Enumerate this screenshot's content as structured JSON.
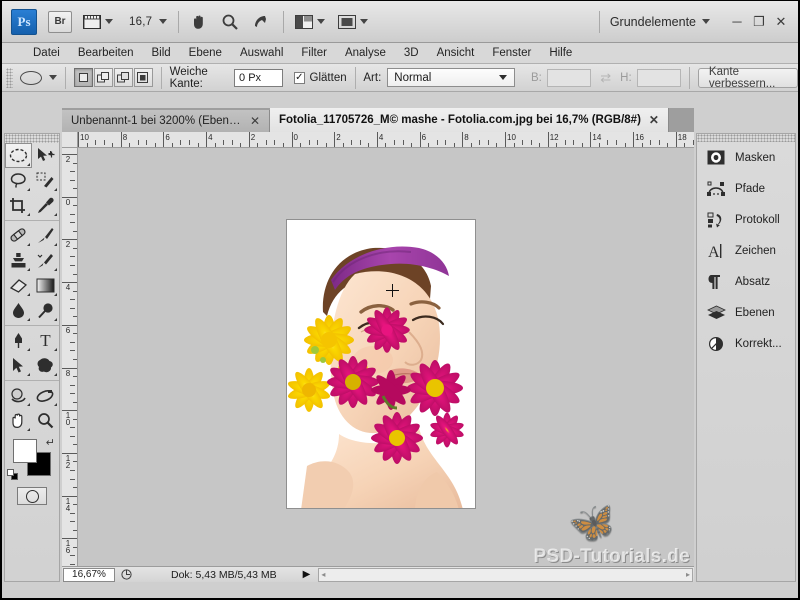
{
  "app": {
    "name": "Adobe Photoshop",
    "logo_text": "Ps",
    "bridge_label": "Br",
    "zoom_level": "16,7",
    "workspace": "Grundelemente"
  },
  "window_controls": {
    "minimize": "─",
    "restore": "❐",
    "close": "✕"
  },
  "menubar": {
    "items": [
      {
        "label": "Datei"
      },
      {
        "label": "Bearbeiten"
      },
      {
        "label": "Bild"
      },
      {
        "label": "Ebene"
      },
      {
        "label": "Auswahl"
      },
      {
        "label": "Filter"
      },
      {
        "label": "Analyse"
      },
      {
        "label": "3D"
      },
      {
        "label": "Ansicht"
      },
      {
        "label": "Fenster"
      },
      {
        "label": "Hilfe"
      }
    ]
  },
  "options_bar": {
    "tool_preset_icon": "ellipse-marquee-icon",
    "selection_modes": [
      "new-selection",
      "add-to-selection",
      "subtract-from-selection",
      "intersect-selection"
    ],
    "feather_label": "Weiche Kante:",
    "feather_value": "0 Px",
    "antialias_label": "Glätten",
    "antialias_checked": true,
    "style_label": "Art:",
    "style_value": "Normal",
    "width_label": "B:",
    "width_value": "",
    "height_label": "H:",
    "height_value": "",
    "refine_edge_label": "Kante verbessern..."
  },
  "tabs": [
    {
      "title": "Unbenannt-1 bei 3200% (Ebene ...",
      "active": false,
      "close": "✕"
    },
    {
      "title": "Fotolia_11705726_M© mashe - Fotolia.com.jpg bei 16,7% (RGB/8#)",
      "active": true,
      "close": "✕"
    }
  ],
  "rulers": {
    "unit": "cm",
    "horizontal_labels": [
      "10",
      "8",
      "6",
      "4",
      "2",
      "0",
      "2",
      "4",
      "6",
      "8",
      "10",
      "12",
      "14",
      "16",
      "18"
    ],
    "vertical_labels": [
      "2",
      "0",
      "2",
      "4",
      "6",
      "8",
      "10",
      "12",
      "14",
      "16"
    ]
  },
  "canvas": {
    "document_name": "Fotolia_11705726_M© mashe - Fotolia.com.jpg",
    "cursor": "crosshair-cursor",
    "watermark_text": "PSD-Tutorials.de",
    "butterfly_icon": "butterfly-icon"
  },
  "statusbar": {
    "zoom": "16,67%",
    "preview_icon": "thumbnail-icon",
    "doc_info": "Dok: 5,43 MB/5,43 MB",
    "menu_arrow": "▶",
    "scroll_left": "◂",
    "scroll_right": "▸"
  },
  "toolbox": {
    "groups": [
      {
        "tools": [
          {
            "name": "elliptical-marquee-tool",
            "glyph": "◯",
            "selected": true,
            "has_flyout": true
          },
          {
            "name": "move-tool",
            "glyph": "✣",
            "selected": false,
            "has_flyout": false
          },
          {
            "name": "lasso-tool",
            "glyph": "❁",
            "selected": false,
            "has_flyout": true
          },
          {
            "name": "quick-selection-tool",
            "glyph": "✦",
            "selected": false,
            "has_flyout": true
          },
          {
            "name": "crop-tool",
            "glyph": "⌧",
            "selected": false,
            "has_flyout": true
          },
          {
            "name": "eyedropper-tool",
            "glyph": "✒",
            "selected": false,
            "has_flyout": true
          }
        ]
      },
      {
        "tools": [
          {
            "name": "spot-healing-brush-tool",
            "glyph": "⊕",
            "selected": false,
            "has_flyout": true
          },
          {
            "name": "brush-tool",
            "glyph": "✎",
            "selected": false,
            "has_flyout": true
          },
          {
            "name": "clone-stamp-tool",
            "glyph": "⚑",
            "selected": false,
            "has_flyout": true
          },
          {
            "name": "history-brush-tool",
            "glyph": "✐",
            "selected": false,
            "has_flyout": true
          },
          {
            "name": "eraser-tool",
            "glyph": "▱",
            "selected": false,
            "has_flyout": true
          },
          {
            "name": "gradient-tool",
            "glyph": "■",
            "selected": false,
            "has_flyout": true
          },
          {
            "name": "blur-tool",
            "glyph": "●",
            "selected": false,
            "has_flyout": true
          },
          {
            "name": "dodge-tool",
            "glyph": "⚲",
            "selected": false,
            "has_flyout": true
          }
        ]
      },
      {
        "tools": [
          {
            "name": "pen-tool",
            "glyph": "✒",
            "selected": false,
            "has_flyout": true
          },
          {
            "name": "horizontal-type-tool",
            "glyph": "T",
            "selected": false,
            "has_flyout": true
          },
          {
            "name": "path-selection-tool",
            "glyph": "➤",
            "selected": false,
            "has_flyout": true
          },
          {
            "name": "custom-shape-tool",
            "glyph": "⬟",
            "selected": false,
            "has_flyout": true
          }
        ]
      },
      {
        "tools": [
          {
            "name": "3d-rotate-tool",
            "glyph": "◔",
            "selected": false,
            "has_flyout": true
          },
          {
            "name": "3d-orbit-tool",
            "glyph": "◑",
            "selected": false,
            "has_flyout": true
          },
          {
            "name": "hand-tool",
            "glyph": "✋",
            "selected": false,
            "has_flyout": true
          },
          {
            "name": "zoom-tool",
            "glyph": "⚲",
            "selected": false,
            "has_flyout": false
          }
        ]
      }
    ],
    "foreground_color": "#ffffff",
    "background_color": "#000000",
    "swap_colors_icon": "swap-arrows-icon",
    "default_colors_icon": "default-colors-icon",
    "quick_mask_icon": "quick-mask-icon"
  },
  "dock": {
    "items": [
      {
        "label": "Masken",
        "icon": "mask-icon"
      },
      {
        "label": "Pfade",
        "icon": "paths-icon"
      },
      {
        "label": "Protokoll",
        "icon": "history-icon"
      },
      {
        "label": "Zeichen",
        "icon": "character-icon"
      },
      {
        "label": "Absatz",
        "icon": "paragraph-icon"
      },
      {
        "label": "Ebenen",
        "icon": "layers-icon"
      },
      {
        "label": "Korrekt...",
        "icon": "adjustments-icon"
      }
    ]
  },
  "colors": {
    "accent": "#2a7fd4",
    "chrome": "#d4d4d4",
    "canvas_bg": "#c6c6c6",
    "headband": "#9c3fa0",
    "flower_magenta": "#d4147e",
    "flower_yellow": "#f7d200"
  }
}
